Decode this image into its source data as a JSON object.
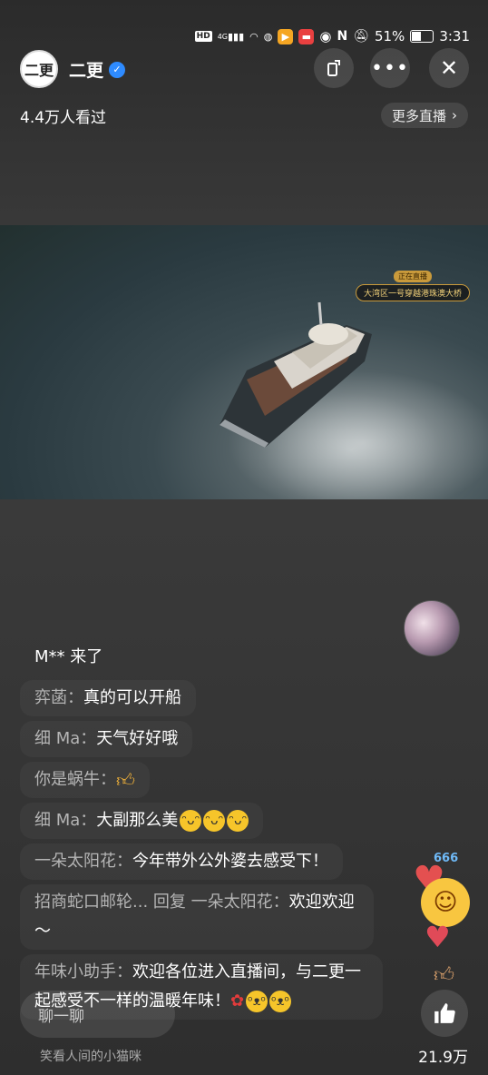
{
  "status_bar": {
    "hd_label": "HD",
    "network": "4G",
    "battery_percent": "51%",
    "battery_level": 0.51,
    "time": "3:31"
  },
  "header": {
    "avatar_text": "二更",
    "channel_name": "二更",
    "verified": true,
    "viewers": "4.4万人看过",
    "more_live_label": "更多直播"
  },
  "video": {
    "badge_top": "正在直播",
    "badge_main": "大湾区一号穿越港珠澳大桥"
  },
  "comments": [
    {
      "type": "join",
      "text": "M** 来了"
    },
    {
      "user": "弈菡：",
      "text": "真的可以开船",
      "emojis": []
    },
    {
      "user": "细 Ma：",
      "text": "天气好好哦",
      "emojis": []
    },
    {
      "user": "你是蜗牛：",
      "text": "",
      "emojis": [
        "thumbs-up"
      ]
    },
    {
      "user": "细 Ma：",
      "text": "大副那么美",
      "emojis": [
        "grin",
        "grin",
        "grin"
      ]
    },
    {
      "user": "一朵太阳花：",
      "text": "今年带外公外婆去感受下！",
      "emojis": []
    },
    {
      "user": "招商蛇口邮轮... 回复 一朵太阳花：",
      "text": "欢迎欢迎～",
      "emojis": []
    },
    {
      "user": "年味小助手：",
      "text": "欢迎各位进入直播间，与二更一起感受不一样的温暖年味！",
      "emojis": [
        "rose",
        "tongue",
        "tongue"
      ]
    }
  ],
  "floating": {
    "tag": "666"
  },
  "bottom": {
    "chat_placeholder": "聊一聊",
    "ticker": "笑看人间的小猫咪",
    "like_count": "21.9万"
  },
  "colors": {
    "verified": "#2e8bff",
    "badge_gold": "#c99a3b",
    "heart": "#e45050"
  }
}
